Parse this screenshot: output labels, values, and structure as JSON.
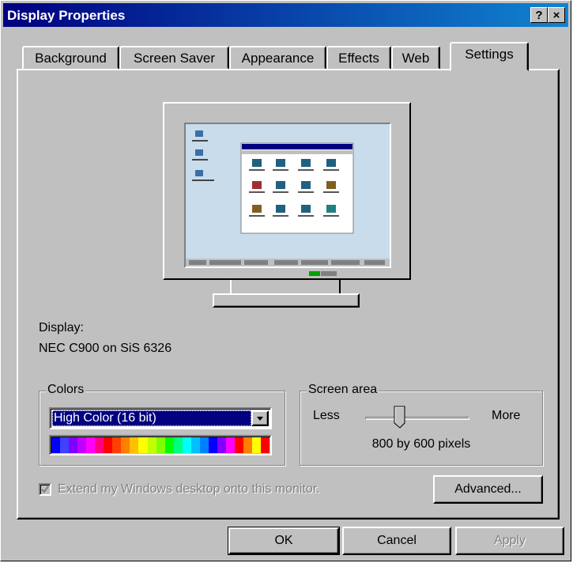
{
  "window": {
    "title": "Display Properties",
    "help_button": "?",
    "close_button": "×"
  },
  "tabs": [
    {
      "label": "Background"
    },
    {
      "label": "Screen Saver"
    },
    {
      "label": "Appearance"
    },
    {
      "label": "Effects"
    },
    {
      "label": "Web"
    },
    {
      "label": "Settings",
      "active": true
    }
  ],
  "display": {
    "label": "Display:",
    "value": "NEC C900 on SiS 6326"
  },
  "colors": {
    "group_label": "Colors",
    "selected": "High Color (16 bit)",
    "palette": [
      "#0000ff",
      "#4040ff",
      "#8000ff",
      "#c000ff",
      "#ff00ff",
      "#ff0080",
      "#ff0000",
      "#ff4000",
      "#ff8000",
      "#ffc000",
      "#ffff00",
      "#c0ff00",
      "#80ff00",
      "#00ff00",
      "#00ff80",
      "#00ffff",
      "#00c0ff",
      "#0080ff",
      "#0000ff",
      "#8000ff",
      "#ff00ff",
      "#ff0000",
      "#ff8000",
      "#ffff00",
      "#ff0000"
    ]
  },
  "screen_area": {
    "group_label": "Screen area",
    "less": "Less",
    "more": "More",
    "value": "800 by 600 pixels",
    "slider_level": 0.33
  },
  "extend_checkbox": {
    "label": "Extend my Windows desktop onto this monitor.",
    "checked": true,
    "disabled": true
  },
  "buttons": {
    "advanced": "Advanced...",
    "ok": "OK",
    "cancel": "Cancel",
    "apply": "Apply"
  }
}
